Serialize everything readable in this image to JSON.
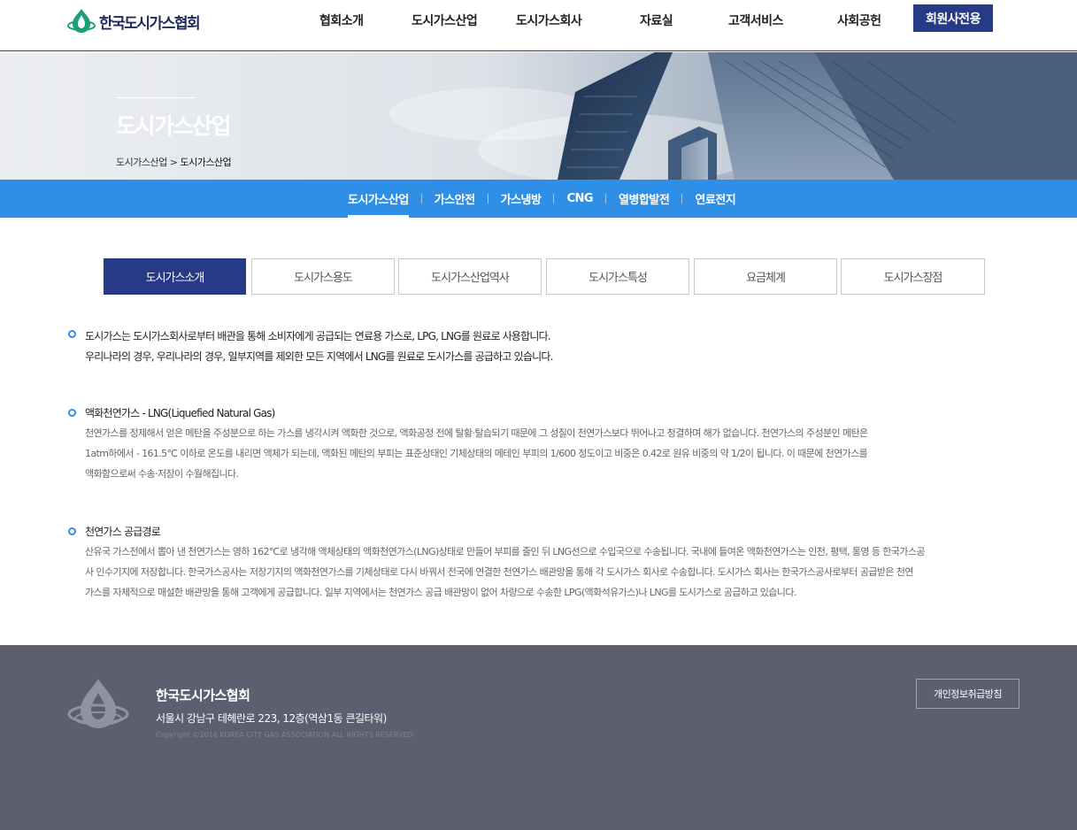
{
  "header": {
    "logo_text": "한국도시가스협회",
    "menu": [
      "협회소개",
      "도시가스산업",
      "도시가스회사",
      "자료실",
      "고객서비스",
      "사회공헌"
    ],
    "member_button": "회원사전용"
  },
  "banner": {
    "title": "도시가스산업",
    "breadcrumb_parent": "도시가스산업",
    "breadcrumb_sep": ">",
    "breadcrumb_current": "도시가스산업"
  },
  "subnav": {
    "items": [
      "도시가스산업",
      "가스안전",
      "가스냉방",
      "CNG",
      "열병합발전",
      "연료전지"
    ],
    "active_index": 0
  },
  "tabs": {
    "items": [
      "도시가스소개",
      "도시가스용도",
      "도시가스산업역사",
      "도시가스특성",
      "요금체계",
      "도시가스장점"
    ],
    "active_index": 0
  },
  "content": {
    "intro": {
      "line1": "도시가스는 도시가스회사로부터 배관을 통해 소비자에게 공급되는 연료용 가스로, LPG, LNG를 원료로 사용합니다.",
      "line2": "우리나라의 경우, 우리나라의 경우, 일부지역를 제외한 모든 지역에서 LNG를 원료로 도시가스를 공급하고 있습니다."
    },
    "lng": {
      "title": "액화천연가스 - LNG(Liquefied Natural Gas)",
      "line1": "천연가스를 정제해서 얻은 메탄을 주성분으로 하는 가스를 냉각시켜 액화한 것으로, 액화공정 전에 탈황·탈습되기 때문에 그 성질이 천연가스보다 뛰어나고 청결하며 해가 없습니다. 천연가스의 주성분인 메탄은",
      "line2": "1atm하에서  - 161.5℃ 이하로 온도를 내리면 액체가 되는데, 액화된 메탄의 부피는 표준상태인 기체상태의 메테인 부피의 1/600 정도이고 비중은 0.42로 원유 비중의 약 1/2이 됩니다. 이 때문에 천연가스를",
      "line3": "액화함으로써 수송·저장이 수월해집니다."
    },
    "supply": {
      "title": "천연가스 공급경로",
      "line1": "산유국 가스전에서 뽑아 낸 천연가스는 영하 162℃로 냉각해 액체상태의 액화천연가스(LNG)상태로 만들어 부피를 줄인 뒤 LNG선으로 수입국으로 수송됩니다. 국내에 들여온 액화천연가스는 인천, 평택, 통영 등 한국가스공",
      "line2": "사 인수기지에 저장합니다. 한국가스공사는 저장기지의 액화천연가스를 기체상태로 다시 바꿔서 전국에 연결한 천연가스 배관망을 통해 각 도시가스 회사로 수송합니다. 도시가스 회사는 한국가스공사로부터 공급받은 천연",
      "line3": "가스를 자체적으로 매설한 배관망을 통해 고객에게 공급합니다. 일부 지역에서는 천연가스 공급 배관망이 없어 차량으로 수송한 LPG(액화석유가스)나 LNG를 도시가스로 공급하고 있습니다."
    }
  },
  "footer": {
    "name": "한국도시가스협회",
    "address": "서울시 강남구 테헤란로 223, 12층(역삼1동 큰길타워)",
    "copyright": "Copyright ©2016 KOREA CITY GAS ASSOCIATION ALL RIGHTS RESERVED",
    "privacy_button": "개인정보취급방침"
  },
  "icons": {
    "logo": "flame-drop-logo-icon",
    "bullet": "circle-bullet-icon"
  },
  "colors": {
    "brand_navy": "#263a86",
    "accent_blue": "#2f8fe6",
    "footer_bg": "#5c5f70"
  }
}
